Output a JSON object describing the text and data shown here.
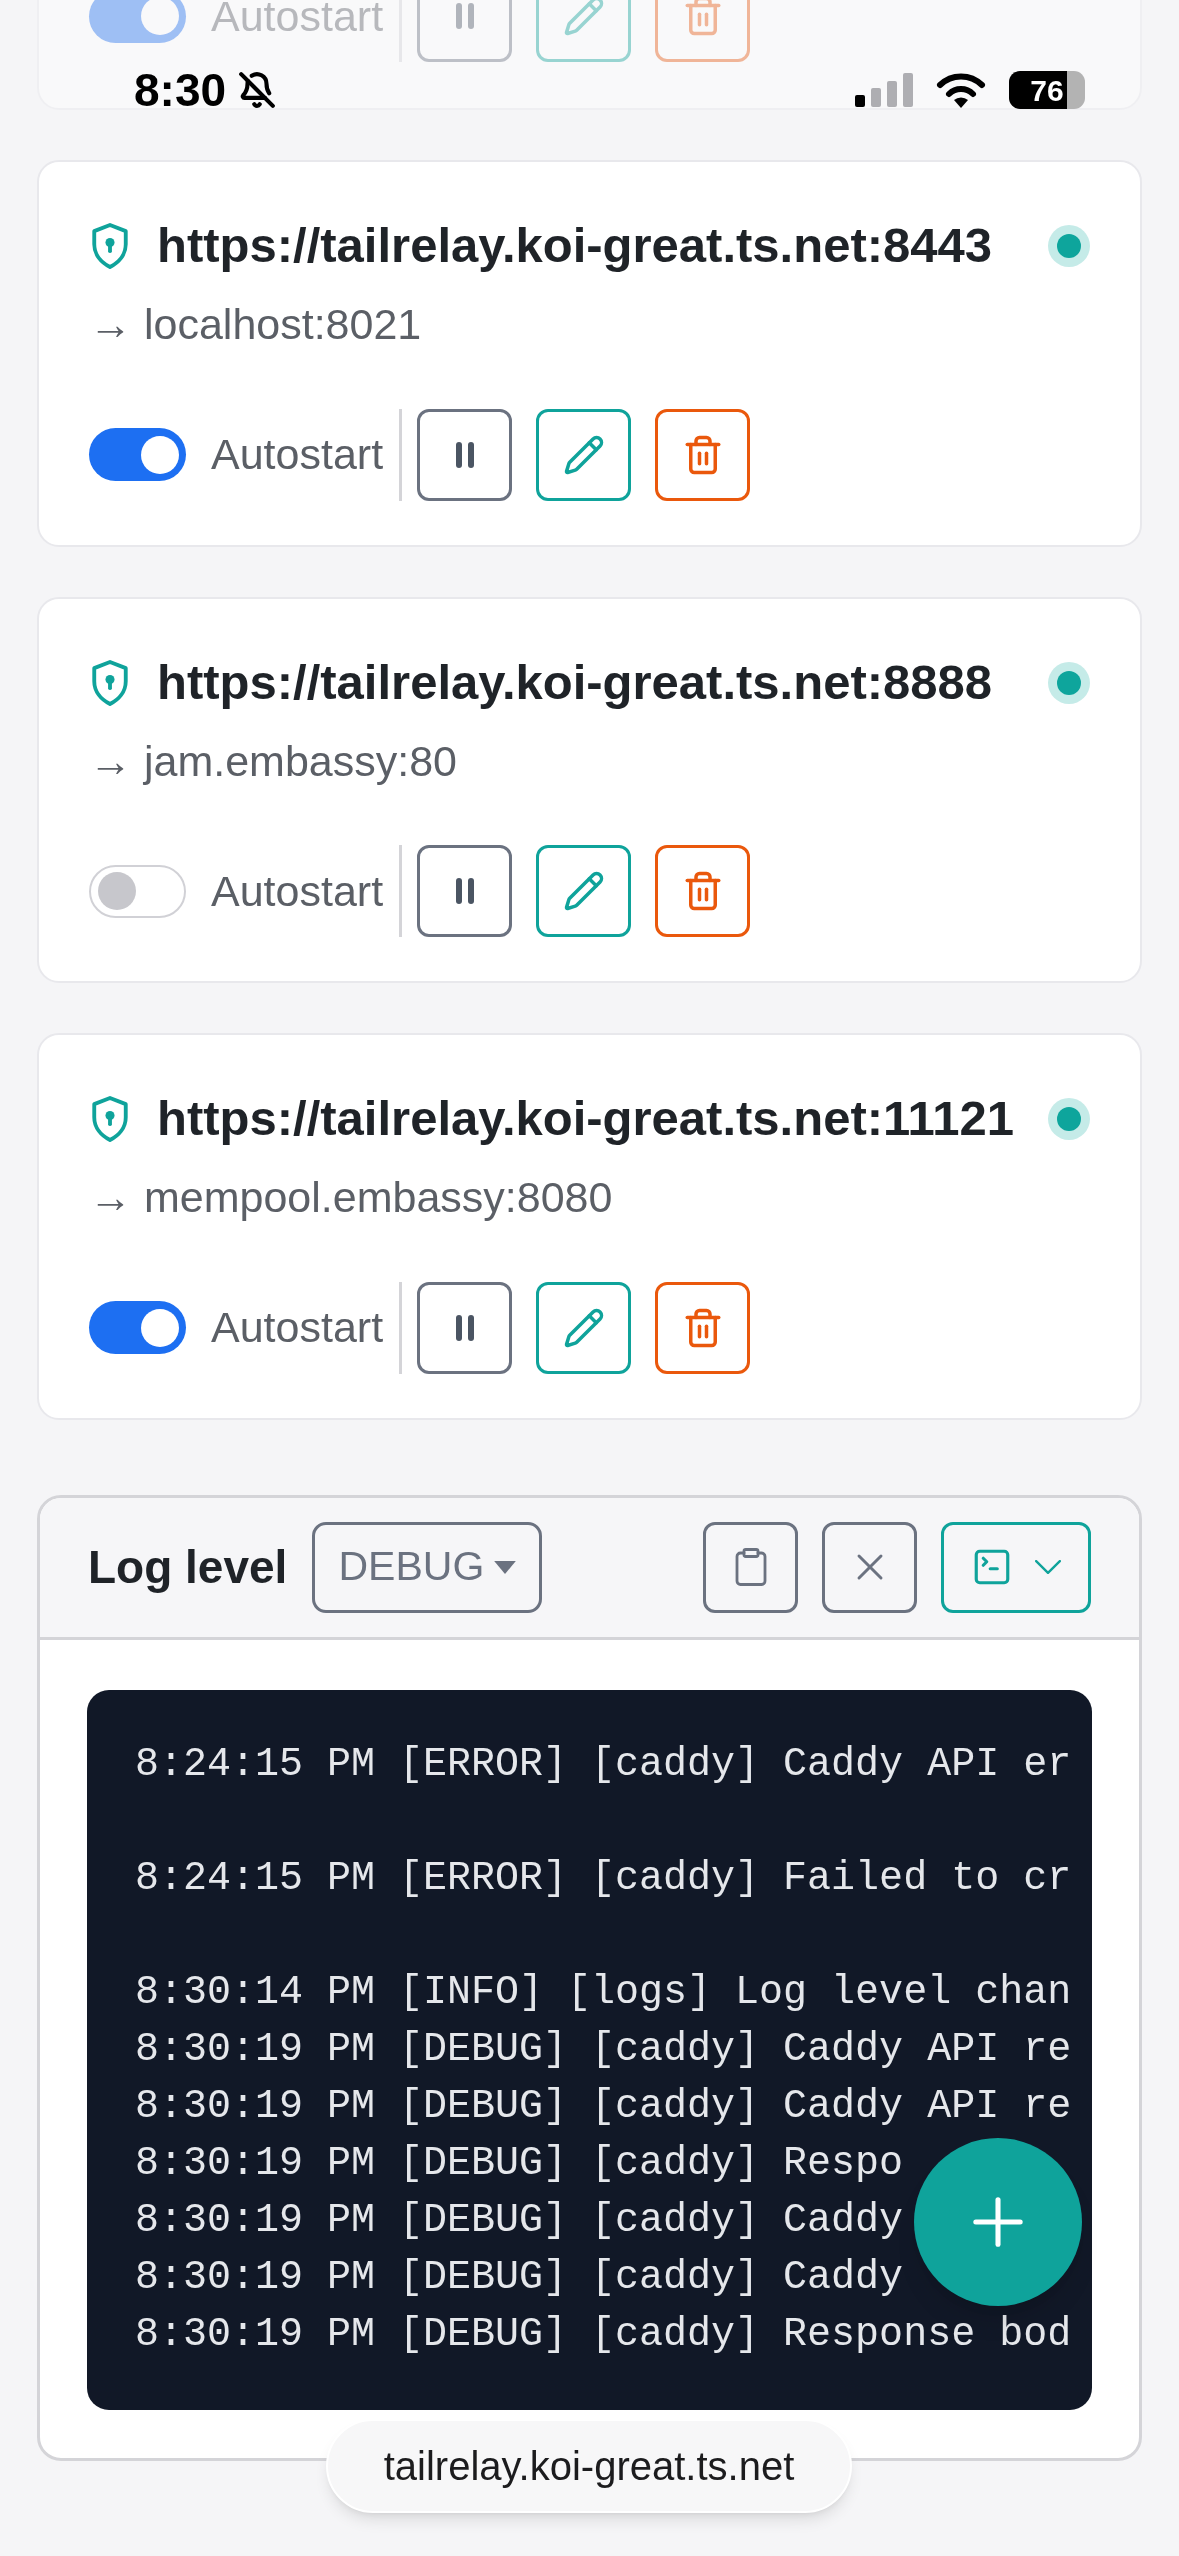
{
  "status_bar": {
    "time": "8:30",
    "battery": "76"
  },
  "partial_card": {
    "autostart": {
      "label": "Autostart",
      "on": true
    }
  },
  "services": [
    {
      "url": "https://tailrelay.koi-great.ts.net:8443",
      "target": "→ localhost:8021",
      "online": true,
      "autostart": {
        "label": "Autostart",
        "on": true
      }
    },
    {
      "url": "https://tailrelay.koi-great.ts.net:8888",
      "target": "→ jam.embassy:80",
      "online": true,
      "autostart": {
        "label": "Autostart",
        "on": false
      }
    },
    {
      "url": "https://tailrelay.koi-great.ts.net:11121",
      "target": "→ mempool.embassy:8080",
      "online": true,
      "autostart": {
        "label": "Autostart",
        "on": true
      }
    }
  ],
  "log_panel": {
    "title": "Log level",
    "level_select": "DEBUG",
    "blocks": [
      [
        "8:24:15 PM [ERROR] [caddy] Caddy API er"
      ],
      [
        "8:24:15 PM [ERROR] [caddy] Failed to cr"
      ],
      [
        "8:30:14 PM [INFO] [logs] Log level chan",
        "8:30:19 PM [DEBUG] [caddy] Caddy API re",
        "8:30:19 PM [DEBUG] [caddy] Caddy API re",
        "8:30:19 PM [DEBUG] [caddy] Respo",
        "8:30:19 PM [DEBUG] [caddy] Caddy",
        "8:30:19 PM [DEBUG] [caddy] Caddy",
        "8:30:19 PM [DEBUG] [caddy] Response bod"
      ]
    ]
  },
  "url_bar": "tailrelay.koi-great.ts.net"
}
